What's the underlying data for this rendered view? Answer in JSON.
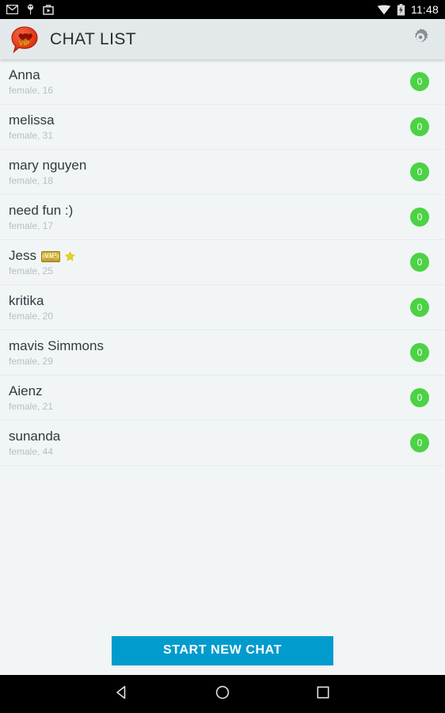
{
  "status_bar": {
    "icons_left": [
      "gmail-icon",
      "pin-icon",
      "bag-icon"
    ],
    "icons_right": [
      "wifi-icon",
      "battery-charging-icon"
    ],
    "time": "11:48"
  },
  "toolbar": {
    "app_icon": "vip-heart-bubble-icon",
    "title": "CHAT LIST",
    "settings_icon": "gear-icon"
  },
  "colors": {
    "toolbar_bg": "#E3E9EB",
    "list_bg": "#F1F5F6",
    "badge_green": "#4CD245",
    "button_blue": "#029BCE",
    "name_text": "#2F3A40",
    "sub_text": "#B7BEC3",
    "vip_gold": "#C9A227",
    "star_gold": "#E8D21A"
  },
  "chats": [
    {
      "name": "Anna",
      "subtitle": "female, 16",
      "count": "0",
      "vip": false,
      "star": false
    },
    {
      "name": "melissa",
      "subtitle": "female, 31",
      "count": "0",
      "vip": false,
      "star": false
    },
    {
      "name": "mary nguyen",
      "subtitle": "female, 18",
      "count": "0",
      "vip": false,
      "star": false
    },
    {
      "name": "need fun :)",
      "subtitle": "female, 17",
      "count": "0",
      "vip": false,
      "star": false
    },
    {
      "name": "Jess",
      "subtitle": "female, 25",
      "count": "0",
      "vip": true,
      "star": true,
      "vip_label": "VIP"
    },
    {
      "name": "kritika",
      "subtitle": "female, 20",
      "count": "0",
      "vip": false,
      "star": false
    },
    {
      "name": "mavis Simmons",
      "subtitle": "female, 29",
      "count": "0",
      "vip": false,
      "star": false
    },
    {
      "name": "Aienz",
      "subtitle": "female, 21",
      "count": "0",
      "vip": false,
      "star": false
    },
    {
      "name": "sunanda",
      "subtitle": "female, 44",
      "count": "0",
      "vip": false,
      "star": false
    }
  ],
  "bottom": {
    "start_chat_label": "START NEW CHAT"
  },
  "nav_bar": {
    "back": "back-triangle-icon",
    "home": "home-circle-icon",
    "recents": "recents-square-icon"
  }
}
